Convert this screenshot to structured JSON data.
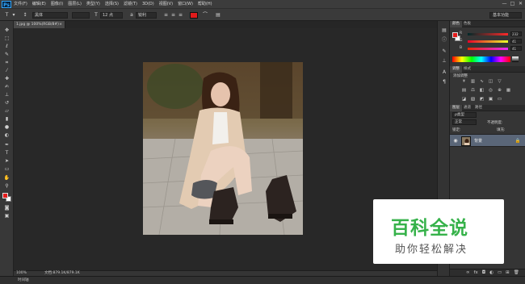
{
  "app": {
    "logo": "Ps"
  },
  "menu": [
    "文件(F)",
    "编辑(E)",
    "图像(I)",
    "图层(L)",
    "类型(Y)",
    "选择(S)",
    "滤镜(T)",
    "3D(D)",
    "视图(V)",
    "窗口(W)",
    "帮助(H)"
  ],
  "window_controls": [
    "—",
    "□",
    "✕"
  ],
  "options": {
    "font_family": "黑体",
    "font_size": "12 点",
    "aa_mode": "锐利",
    "workspace": "基本功能",
    "text_color": "#e11b1b"
  },
  "document": {
    "tab_label": "1.jpg @ 100%(RGB/8#)",
    "tab_close": "×",
    "zoom": "100%",
    "doc_size": "文档:879.1K/879.1K"
  },
  "timeline_label": "时间轴",
  "tools": {
    "icons": [
      "move-icon",
      "marquee-icon",
      "lasso-icon",
      "quick-select-icon",
      "crop-icon",
      "eyedropper-icon",
      "healing-brush-icon",
      "brush-icon",
      "clone-stamp-icon",
      "history-brush-icon",
      "eraser-icon",
      "gradient-icon",
      "blur-icon",
      "dodge-icon",
      "pen-icon",
      "type-icon",
      "path-select-icon",
      "rectangle-icon",
      "hand-icon",
      "zoom-icon"
    ],
    "foreground": "#e41c1c",
    "background": "#ffffff"
  },
  "color_panel": {
    "tabs": [
      "颜色",
      "色板"
    ],
    "r_label": "R",
    "r_value": "232",
    "g_label": "G",
    "g_value": "41",
    "b_label": "B",
    "b_value": "41"
  },
  "adjustments_panel": {
    "tabs": [
      "调整",
      "样式"
    ],
    "title": "添加调整"
  },
  "layers_panel": {
    "tabs": [
      "图层",
      "通道",
      "路径"
    ],
    "kind_filter": "ρ类型",
    "blend_mode": "正常",
    "opacity_label": "不透明度:",
    "lock_label": "锁定:",
    "fill_label": "填充:",
    "layer_name": "背景"
  },
  "watermark": {
    "title": "百科全说",
    "subtitle": "助你轻松解决",
    "color": "#36b24a"
  }
}
